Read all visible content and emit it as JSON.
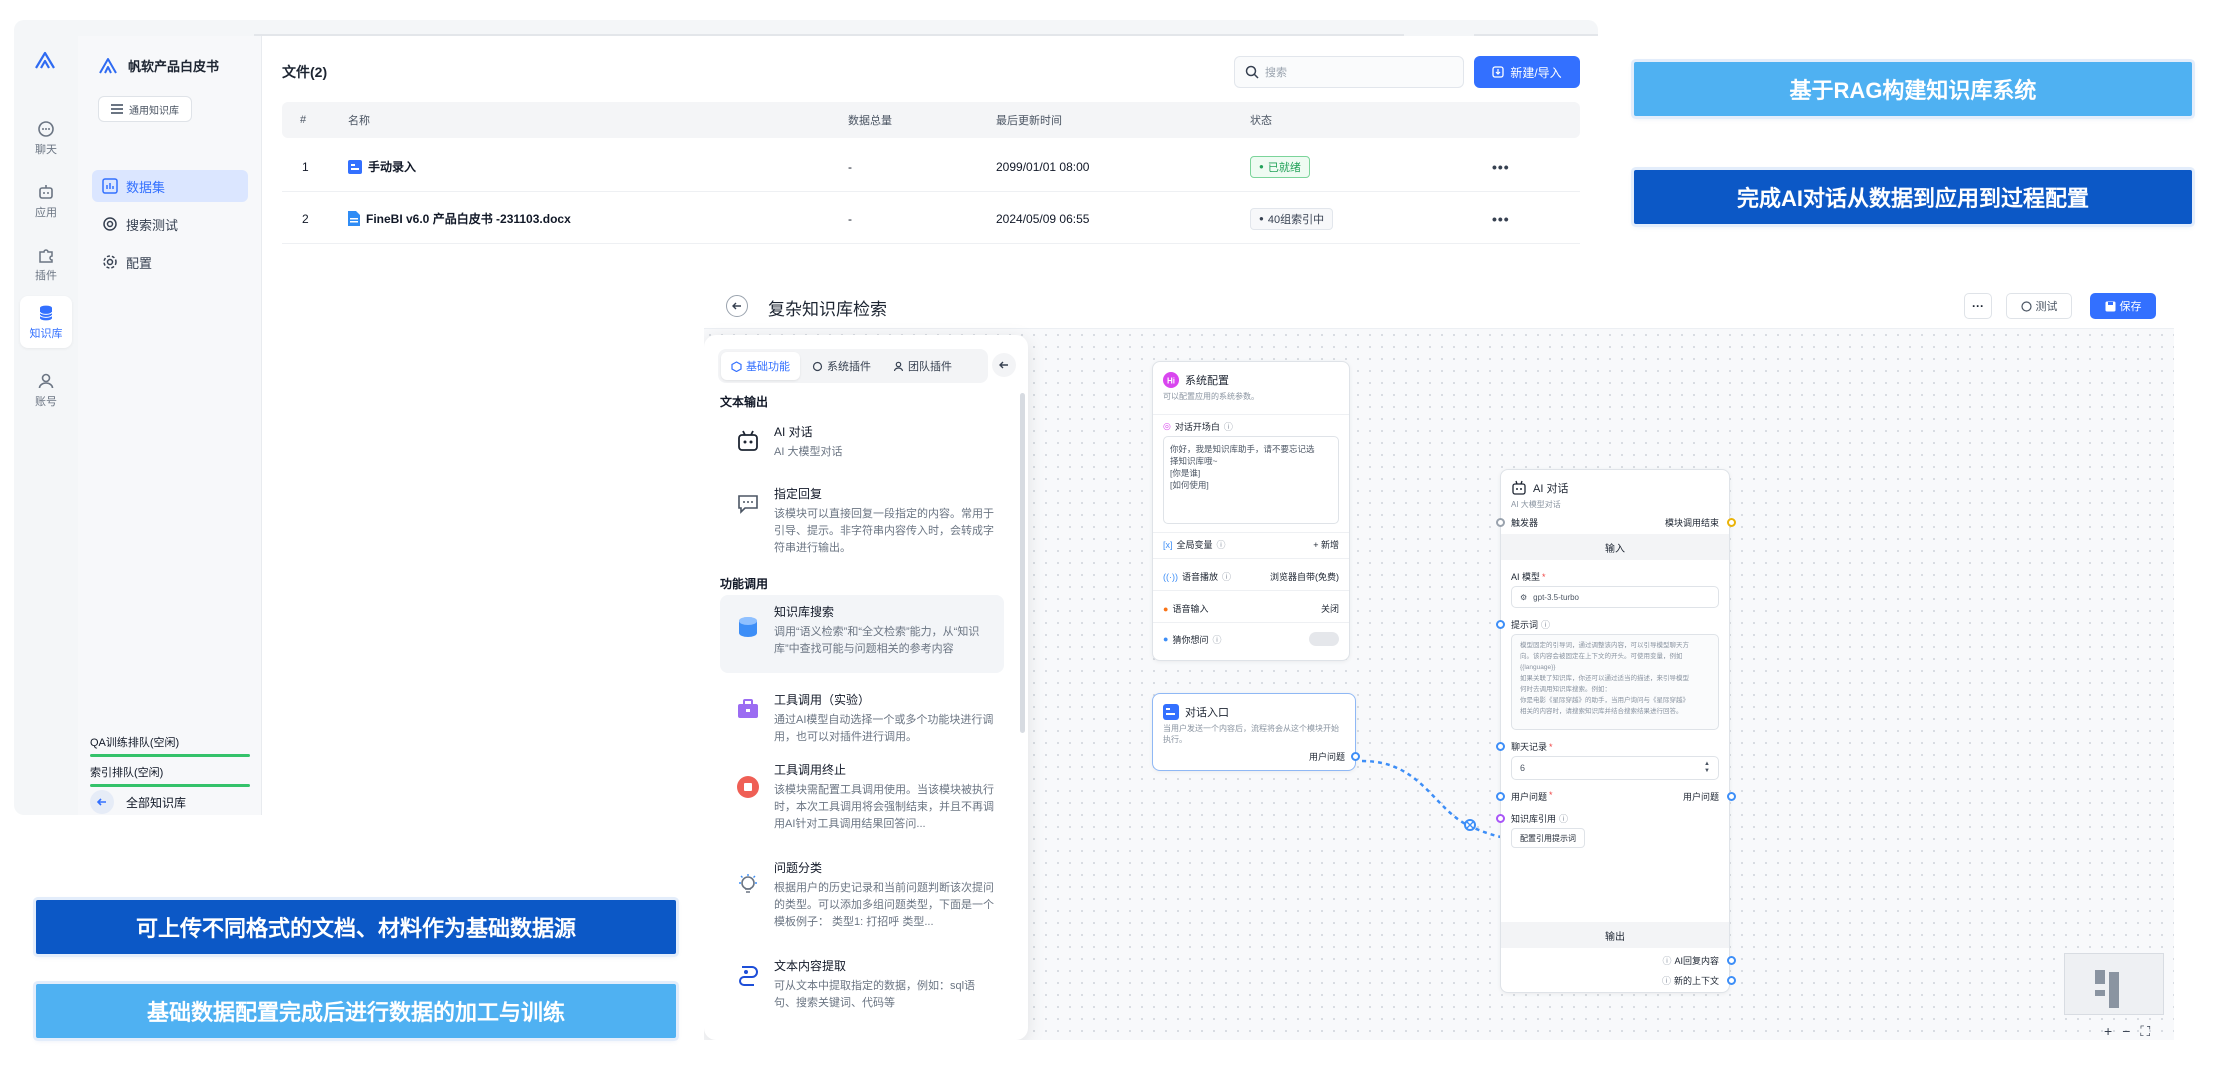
{
  "kb": {
    "rail": [
      {
        "label": "聊天",
        "icon": "chat-icon"
      },
      {
        "label": "应用",
        "icon": "robot-icon"
      },
      {
        "label": "插件",
        "icon": "puzzle-icon"
      },
      {
        "label": "知识库",
        "icon": "database-icon",
        "active": true
      },
      {
        "label": "账号",
        "icon": "user-icon"
      }
    ],
    "kb_name": "帆软产品白皮书",
    "kb_type": "通用知识库",
    "menu": [
      {
        "label": "数据集",
        "active": true
      },
      {
        "label": "搜索测试"
      },
      {
        "label": "配置"
      }
    ],
    "queues": [
      {
        "label": "QA训练排队(空闲)"
      },
      {
        "label": "索引排队(空闲)"
      }
    ],
    "back_label": "全部知识库",
    "files_title": "文件(2)",
    "search_placeholder": "搜索",
    "new_button": "新建/导入",
    "table": {
      "headers": [
        "#",
        "名称",
        "数据总量",
        "最后更新时间",
        "状态"
      ],
      "rows": [
        {
          "idx": "1",
          "name": "手动录入",
          "total": "-",
          "updated": "2099/01/01 08:00",
          "status": "已就绪",
          "status_kind": "ready"
        },
        {
          "idx": "2",
          "name": "FineBI v6.0 产品白皮书 -231103.docx",
          "total": "-",
          "updated": "2024/05/09 06:55",
          "status": "40组索引中",
          "status_kind": "indexing"
        }
      ]
    }
  },
  "banners": {
    "top_right_1": "基于RAG构建知识库系统",
    "top_right_2": "完成AI对话从数据到应用到过程配置",
    "bottom_left_1": "可上传不同格式的文档、材料作为基础数据源",
    "bottom_left_2": "基础数据配置完成后进行数据的加工与训练"
  },
  "workflow": {
    "title": "复杂知识库检索",
    "test_label": "测试",
    "save_label": "保存",
    "panel": {
      "tabs": [
        "基础功能",
        "系统插件",
        "团队插件"
      ],
      "sections": {
        "text_output": "文本输出",
        "function_call": "功能调用"
      },
      "items": [
        {
          "name": "AI 对话",
          "desc": "AI 大模型对话"
        },
        {
          "name": "指定回复",
          "desc": "该模块可以直接回复一段指定的内容。常用于引导、提示。非字符串内容传入时，会转成字符串进行输出。"
        },
        {
          "name": "知识库搜索",
          "desc": "调用“语义检索”和“全文检索”能力，从“知识库”中查找可能与问题相关的参考内容"
        },
        {
          "name": "工具调用（实验）",
          "desc": "通过AI模型自动选择一个或多个功能块进行调用，也可以对插件进行调用。"
        },
        {
          "name": "工具调用终止",
          "desc": "该模块需配置工具调用使用。当该模块被执行时，本次工具调用将会强制结束，并且不再调用AI针对工具调用结果回答问..."
        },
        {
          "name": "问题分类",
          "desc": "根据用户的历史记录和当前问题判断该次提问的类型。可以添加多组问题类型，下面是一个模板例子： 类型1: 打招呼 类型..."
        },
        {
          "name": "文本内容提取",
          "desc": "可从文本中提取指定的数据，例如：sql语句、搜索关键词、代码等"
        }
      ]
    },
    "system_node": {
      "title": "系统配置",
      "subtitle": "可以配置应用的系统参数。",
      "opening_label": "对话开场白",
      "opening_text": [
        "你好，我是知识库助手，请不要忘记选",
        "择知识库哦~",
        "[你是谁]",
        "[如何使用]"
      ],
      "global_var_label": "全局变量",
      "global_var_action": "+ 新增",
      "tts_label": "语音播放",
      "tts_value": "浏览器自带(免费)",
      "voice_input_label": "语音输入",
      "voice_input_value": "关闭",
      "guess_label": "猜你想问"
    },
    "entry_node": {
      "title": "对话入口",
      "subtitle": "当用户发送一个内容后，流程将会从这个模块开始执行。",
      "output": "用户问题"
    },
    "ai_node": {
      "title": "AI 对话",
      "subtitle": "AI 大模型对话",
      "trigger": "触发器",
      "end_label": "模块调用结束",
      "input_section": "输入",
      "model_label": "AI 模型",
      "model_value": "gpt-3.5-turbo",
      "prompt_label": "提示词",
      "prompt_text": [
        "模型固定的引导词，通过调整该内容，可以引导模型聊天方",
        "向。该内容会被固定在上下文的开头。可使用变量，例如",
        "{{language}}",
        "如果关联了知识库，你还可以通过适当的描述，来引导模型",
        "何时去调用知识库搜索。例如：",
        "你是电影《星际穿越》的助手，当用户询问与《星际穿越》",
        "相关的内容时，请搜索知识库并结合搜索结果进行回答。"
      ],
      "history_label": "聊天记录",
      "history_value": "6",
      "question_label": "用户问题",
      "question_out": "用户问题",
      "kb_ref_label": "知识库引用",
      "kb_ref_button": "配置引用提示词",
      "output_section": "输出",
      "out_1": "AI回复内容",
      "out_2": "新的上下文"
    },
    "zoom_controls": [
      "+",
      "−",
      "⛶"
    ]
  },
  "colors": {
    "accent": "#3370ff",
    "banner_light": "#4fb1f2",
    "banner_dark": "#0c58c6",
    "ready_green": "#22a259"
  }
}
